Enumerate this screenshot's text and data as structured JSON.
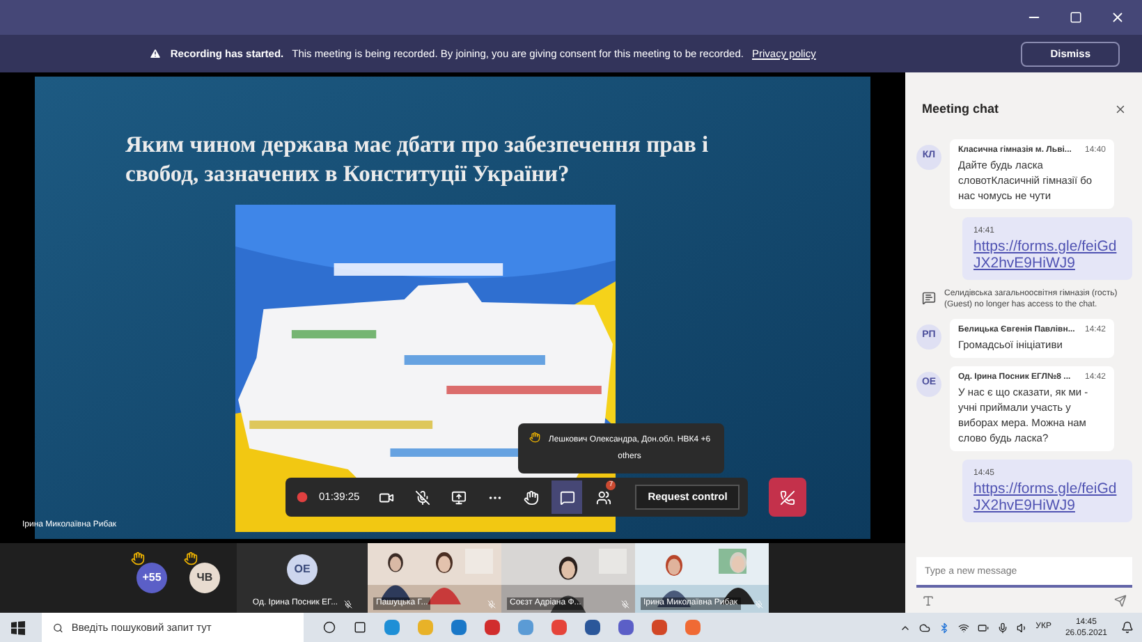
{
  "banner": {
    "title": "Recording has started.",
    "text": "This meeting is being recorded. By joining, you are giving consent for this meeting to be recorded.",
    "link": "Privacy policy",
    "button": "Dismiss"
  },
  "slide": {
    "title": "Яким чином держава має дбати про забезпечення прав і свобод, зазначених в  Конституції України?"
  },
  "presenter": "Ірина Миколаївна Рибак",
  "raised_hands": {
    "text": "Лешкович Олександра, Дон.обл. НВК4 +6 others"
  },
  "controls": {
    "timer": "01:39:25",
    "buttons": [
      {
        "kind": "camera",
        "selected": false
      },
      {
        "kind": "mic-off",
        "selected": false
      },
      {
        "kind": "share",
        "selected": false
      },
      {
        "kind": "more",
        "selected": false
      },
      {
        "kind": "hand",
        "selected": false
      },
      {
        "kind": "chat",
        "selected": true
      },
      {
        "kind": "people",
        "selected": false,
        "badge": "7"
      }
    ],
    "request": "Request control"
  },
  "tiles": [
    {
      "kind": "avatars",
      "avatars": [
        {
          "initials": "+55",
          "color": "#5b5fc7",
          "hand": true
        },
        {
          "initials": "ЧВ",
          "color": "#e8dcd0",
          "hand": true
        }
      ]
    },
    {
      "kind": "avatar",
      "initials": "ОЕ",
      "name": "Од. Ірина Посник ЕГ..."
    },
    {
      "kind": "video",
      "name": "Пашуцька Г..."
    },
    {
      "kind": "video",
      "name": "Соєзт Адріана Ф..."
    },
    {
      "kind": "video",
      "name": "Ірина Миколаївна Рибак"
    }
  ],
  "chat": {
    "title": "Meeting chat",
    "messages": [
      {
        "kind": "message",
        "initials": "КЛ",
        "sender": "Класична гімназія м. Льві...",
        "time": "14:40",
        "text": "Дайте будь ласка словотКласичній гімназії бо нас чомусь не чути"
      },
      {
        "kind": "own",
        "time": "14:41",
        "link": "https://forms.gle/feiGdJX2hvE9HiWJ9"
      },
      {
        "kind": "system",
        "text": "Селидівська загальноосвітня гімназія (гость) (Guest) no longer has access to the chat."
      },
      {
        "kind": "message",
        "initials": "РП",
        "sender": "Белицька Євгенія Павлівн...",
        "time": "14:42",
        "text": "Громадсьої ініціативи"
      },
      {
        "kind": "message",
        "initials": "ОЕ",
        "sender": "Од. Ірина Посник ЕГЛ№8 ...",
        "time": "14:42",
        "text": "У нас є що сказати, як ми - учні приймали участь у виборах мера. Можна нам слово будь ласка?"
      },
      {
        "kind": "own",
        "time": "14:45",
        "link": "https://forms.gle/feiGdJX2hvE9HiWJ9"
      }
    ],
    "input": {
      "placeholder": "Type a new message"
    }
  },
  "taskbar": {
    "search": {
      "placeholder": "Введіть пошуковий запит тут"
    },
    "language": "УКР",
    "time": "14:45",
    "date": "26.05.2021"
  }
}
